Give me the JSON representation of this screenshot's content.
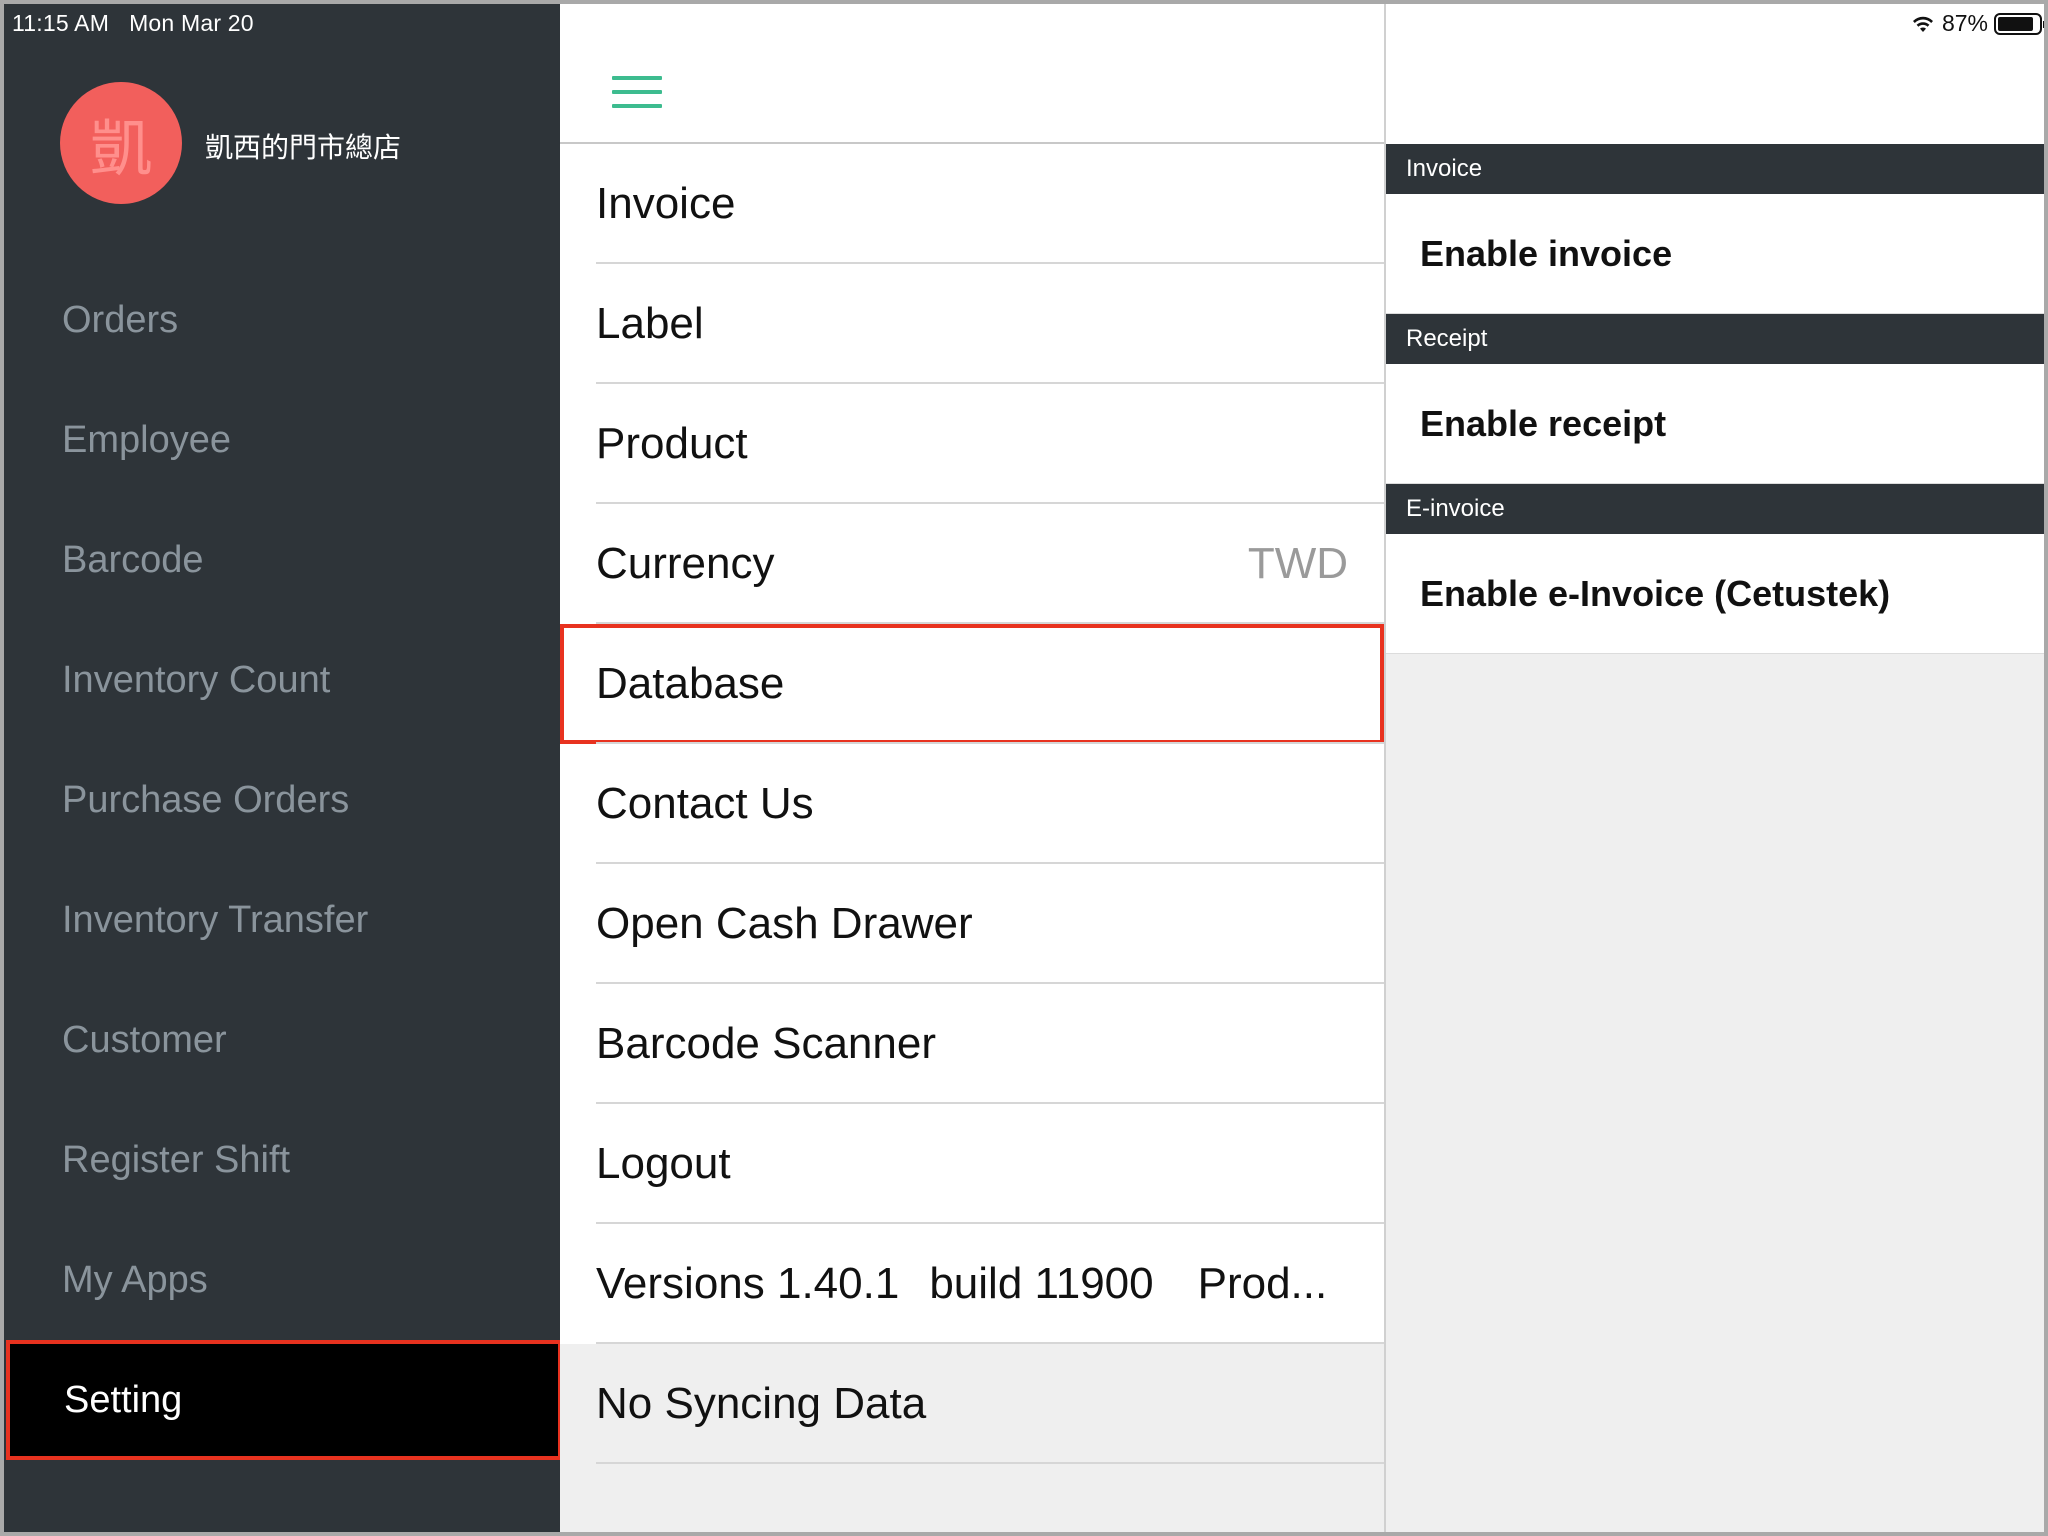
{
  "status_bar": {
    "time": "11:15 AM",
    "date": "Mon Mar 20",
    "battery_percent": "87%",
    "battery_level": 0.87
  },
  "store": {
    "avatar_char": "凱",
    "name": "凱西的門市總店"
  },
  "sidebar": {
    "items": [
      {
        "label": "Orders"
      },
      {
        "label": "Employee"
      },
      {
        "label": "Barcode"
      },
      {
        "label": "Inventory Count"
      },
      {
        "label": "Purchase Orders"
      },
      {
        "label": "Inventory Transfer"
      },
      {
        "label": "Customer"
      },
      {
        "label": "Register Shift"
      },
      {
        "label": "My Apps"
      },
      {
        "label": "Setting",
        "active": true
      }
    ]
  },
  "settings_list": {
    "items": [
      {
        "label": "Invoice"
      },
      {
        "label": "Label"
      },
      {
        "label": "Product"
      },
      {
        "label": "Currency",
        "value": "TWD"
      },
      {
        "label": "Database",
        "highlighted": true
      },
      {
        "label": "Contact Us"
      },
      {
        "label": "Open Cash Drawer"
      },
      {
        "label": "Barcode Scanner"
      },
      {
        "label": "Logout"
      }
    ],
    "version": {
      "version_text": "Versions 1.40.1",
      "build_text": "build 11900",
      "env_text": "Prod..."
    },
    "sync_status": "No Syncing Data"
  },
  "detail": {
    "sections": [
      {
        "header": "Invoice",
        "row": "Enable invoice"
      },
      {
        "header": "Receipt",
        "row": "Enable receipt"
      },
      {
        "header": "E-invoice",
        "row": "Enable e-Invoice (Cetustek)"
      }
    ]
  },
  "colors": {
    "sidebar_bg": "#2e3439",
    "accent_green": "#3dbc8f",
    "highlight_red": "#e8321f",
    "avatar_red": "#f25f5c"
  }
}
